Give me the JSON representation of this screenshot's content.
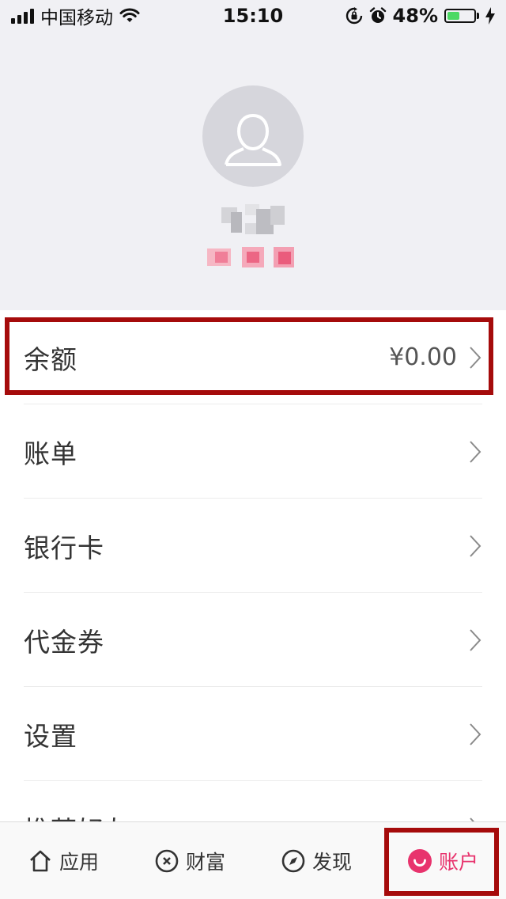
{
  "status_bar": {
    "carrier": "中国移动",
    "time": "15:10",
    "battery_percent": "48%",
    "battery_level": 0.48,
    "icons": [
      "signal-icon",
      "wifi-icon",
      "rotation-lock-icon",
      "alarm-icon",
      "battery-icon",
      "charging-icon"
    ]
  },
  "profile": {
    "avatar_icon": "person-silhouette-icon"
  },
  "menu": {
    "items": [
      {
        "label": "余额",
        "value": "¥0.00"
      },
      {
        "label": "账单"
      },
      {
        "label": "银行卡"
      },
      {
        "label": "代金券"
      },
      {
        "label": "设置"
      },
      {
        "label": "推荐好友"
      }
    ]
  },
  "tabbar": {
    "tabs": [
      {
        "label": "应用",
        "icon": "home-icon"
      },
      {
        "label": "财富",
        "icon": "wealth-icon"
      },
      {
        "label": "发现",
        "icon": "compass-icon"
      },
      {
        "label": "账户",
        "icon": "account-smile-icon",
        "active": true
      }
    ]
  },
  "colors": {
    "accent": "#e8336d",
    "highlight_border": "#a50b0b",
    "battery_green": "#4cd964"
  }
}
